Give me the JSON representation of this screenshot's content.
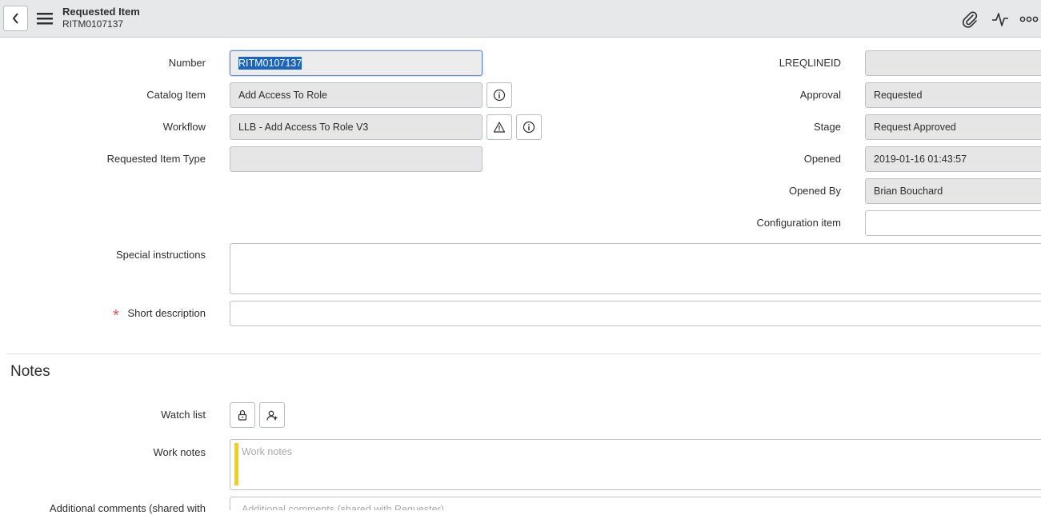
{
  "header": {
    "title": "Requested Item",
    "subtitle": "RITM0107137",
    "icons": [
      "back-icon",
      "hamburger-menu-icon",
      "paperclip-icon",
      "activity-icon",
      "more-options-icon"
    ]
  },
  "form": {
    "left": {
      "number": {
        "label": "Number",
        "value": "RITM0107137"
      },
      "catalog_item": {
        "label": "Catalog Item",
        "value": "Add Access To Role"
      },
      "workflow": {
        "label": "Workflow",
        "value": "LLB - Add Access To Role V3"
      },
      "requested_item_type": {
        "label": "Requested Item Type",
        "value": ""
      }
    },
    "right": {
      "lreqlineid": {
        "label": "LREQLINEID",
        "value": ""
      },
      "approval": {
        "label": "Approval",
        "value": "Requested"
      },
      "stage": {
        "label": "Stage",
        "value": "Request Approved"
      },
      "opened": {
        "label": "Opened",
        "value": "2019-01-16 01:43:57"
      },
      "opened_by": {
        "label": "Opened By",
        "value": "Brian Bouchard"
      },
      "configuration_item": {
        "label": "Configuration item",
        "value": ""
      }
    },
    "special_instructions": {
      "label": "Special instructions",
      "value": ""
    },
    "short_description": {
      "label": "Short description",
      "required_mark": "*",
      "value": ""
    }
  },
  "notes": {
    "section_title": "Notes",
    "watch_list": {
      "label": "Watch list"
    },
    "work_notes": {
      "label": "Work notes",
      "placeholder": "Work notes"
    },
    "additional_comments": {
      "label": "Additional comments (shared with",
      "placeholder": "Additional comments (shared with Requester)"
    }
  },
  "colors": {
    "header_bg": "#e6e8ea",
    "readonly_field_bg": "#e6e6e6",
    "selection_bg": "#1963c3",
    "required_star": "#d9534f",
    "work_notes_bar": "#f7d100"
  }
}
